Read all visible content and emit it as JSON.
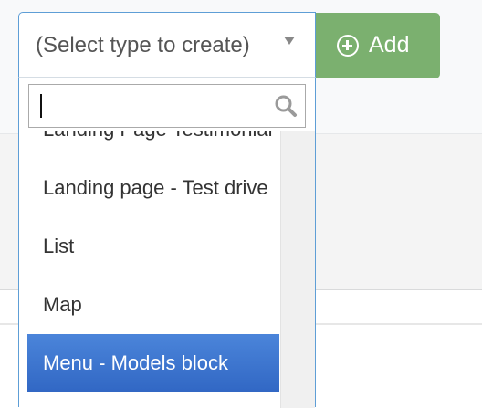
{
  "select": {
    "placeholder": "(Select type to create)",
    "caret_icon": "caret-down-icon"
  },
  "add_button": {
    "label": "Add",
    "icon": "plus-circle-icon",
    "color": "#7bb06f"
  },
  "dropdown": {
    "search": {
      "value": "",
      "placeholder": "",
      "icon": "search-icon"
    },
    "options": [
      {
        "label": "Landing Page Testimonial",
        "selected": false
      },
      {
        "label": "Landing page - Test drive",
        "selected": false
      },
      {
        "label": "List",
        "selected": false
      },
      {
        "label": "Map",
        "selected": false
      },
      {
        "label": "Menu - Models block",
        "selected": true
      }
    ],
    "highlight_color": "#3b73cf",
    "border_color": "#5e9ed6"
  }
}
